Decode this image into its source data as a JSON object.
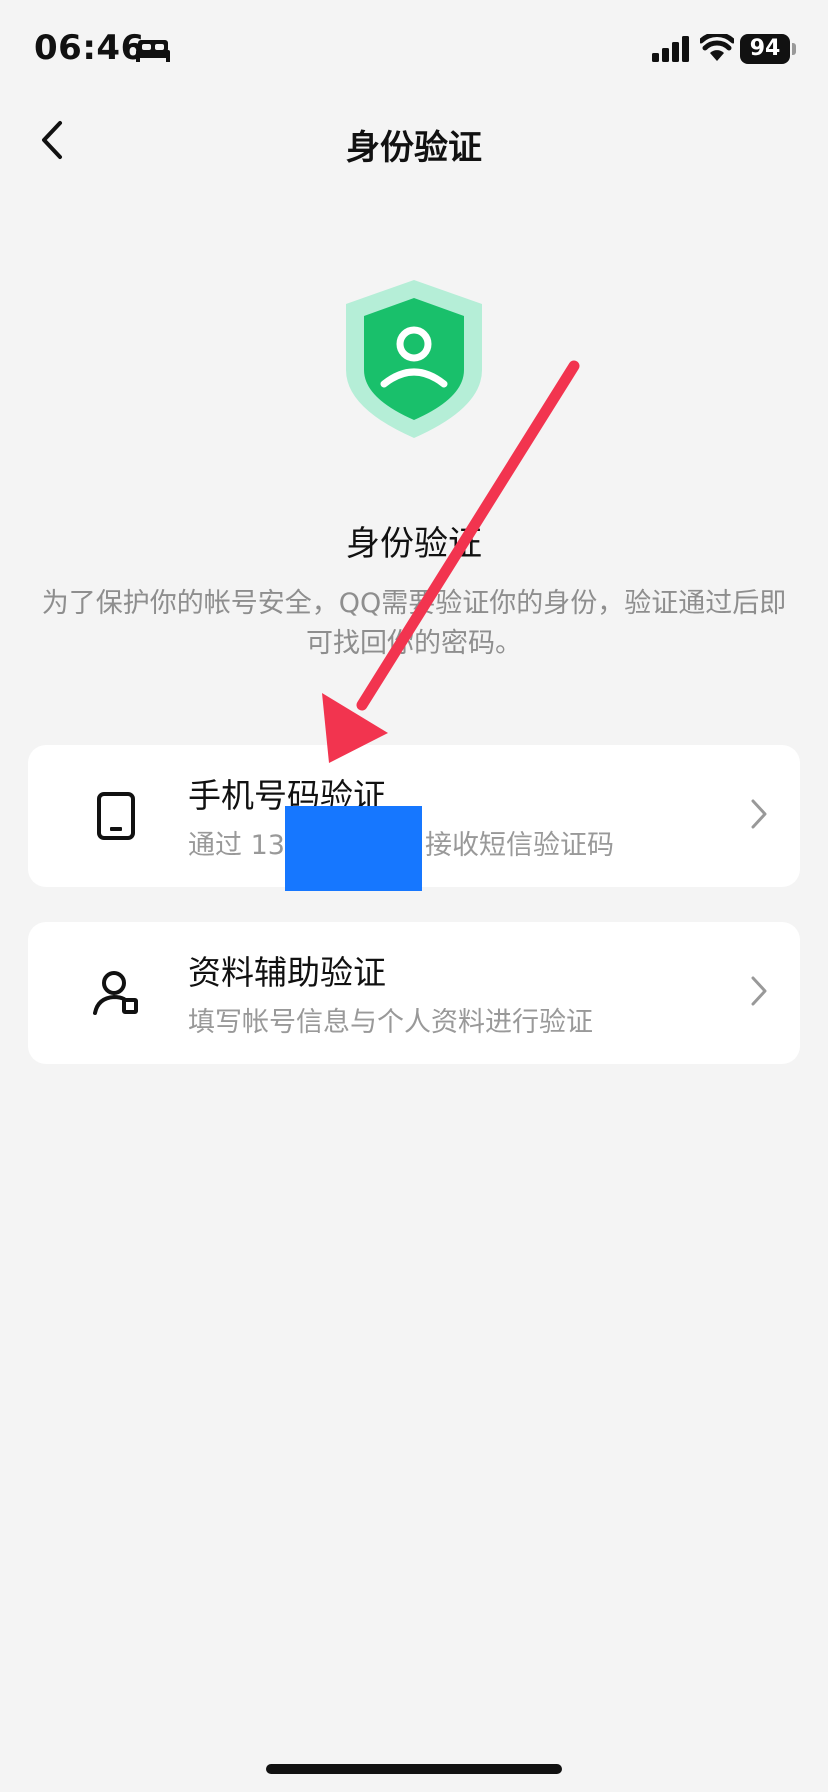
{
  "status_bar": {
    "time": "06:46",
    "battery": "94",
    "icons": [
      "sleep-icon",
      "signal-icon",
      "wifi-icon",
      "battery-icon"
    ]
  },
  "nav": {
    "title": "身份验证",
    "back_icon": "chevron-left-icon"
  },
  "hero": {
    "icon": "shield-user-icon",
    "title": "身份验证",
    "description": "为了保护你的帐号安全，QQ需要验证你的身份，验证通过后即可找回你的密码。"
  },
  "options": [
    {
      "icon": "phone-icon",
      "title": "手机号码验证",
      "subtitle_prefix": "通过 13",
      "subtitle_suffix": "接收短信验证码"
    },
    {
      "icon": "user-badge-icon",
      "title": "资料辅助验证",
      "subtitle": "填写帐号信息与个人资料进行验证"
    }
  ],
  "colors": {
    "accent_green": "#19c06b",
    "shield_light": "#b5eed7",
    "arrow_red": "#f2344f",
    "redaction_blue": "#1677ff"
  }
}
